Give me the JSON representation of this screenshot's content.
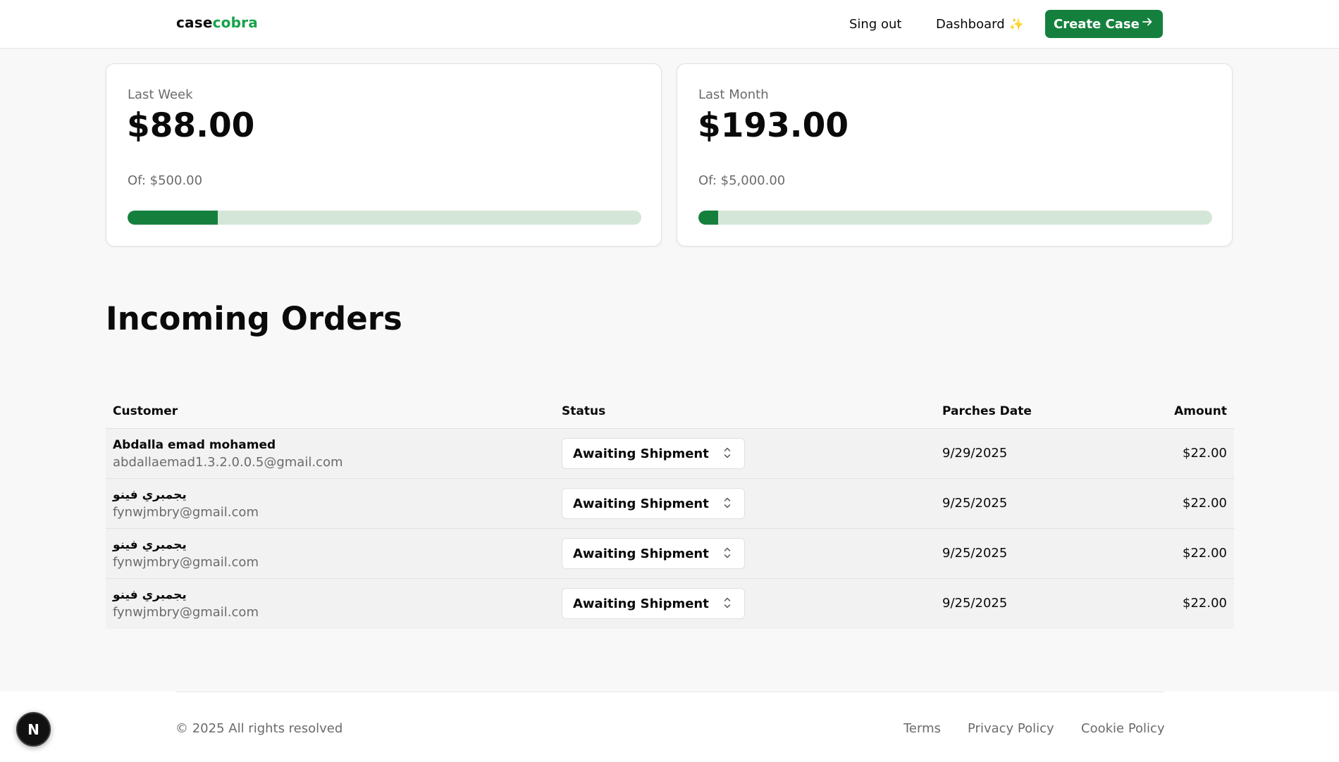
{
  "navbar": {
    "brand_part1": "case",
    "brand_part2": "cobra",
    "signout_label": "Sing out",
    "dashboard_label": "Dashboard",
    "dashboard_icon": "sparkles-icon",
    "create_label": "Create Case",
    "create_icon": "arrow-right-icon",
    "brand_color": "#16a34a",
    "accent_color": "#15803d"
  },
  "stats": {
    "week": {
      "label": "Last Week",
      "value": "$88.00",
      "of_text": "Of: $500.00",
      "progress_percent": 17.6
    },
    "month": {
      "label": "Last Month",
      "value": "$193.00",
      "of_text": "Of: $5,000.00",
      "progress_percent": 3.86
    }
  },
  "orders": {
    "title": "Incoming Orders",
    "columns": {
      "customer": "Customer",
      "status": "Status",
      "date": "Parches Date",
      "amount": "Amount"
    },
    "rows": [
      {
        "name": "Abdalla emad mohamed",
        "email": "abdallaemad1.3.2.0.0.5@gmail.com",
        "status": "Awaiting Shipment",
        "date": "9/29/2025",
        "amount": "$22.00"
      },
      {
        "name": "يجمبري فينو",
        "email": "fynwjmbry@gmail.com",
        "status": "Awaiting Shipment",
        "date": "9/25/2025",
        "amount": "$22.00"
      },
      {
        "name": "يجمبري فينو",
        "email": "fynwjmbry@gmail.com",
        "status": "Awaiting Shipment",
        "date": "9/25/2025",
        "amount": "$22.00"
      },
      {
        "name": "يجمبري فينو",
        "email": "fynwjmbry@gmail.com",
        "status": "Awaiting Shipment",
        "date": "9/25/2025",
        "amount": "$22.00"
      }
    ]
  },
  "footer": {
    "copyright": "© 2025 All rights resolved",
    "links": [
      "Terms",
      "Privacy Policy",
      "Cookie Policy"
    ]
  },
  "dev_badge": {
    "letter": "N",
    "icon": "nextjs-icon"
  }
}
